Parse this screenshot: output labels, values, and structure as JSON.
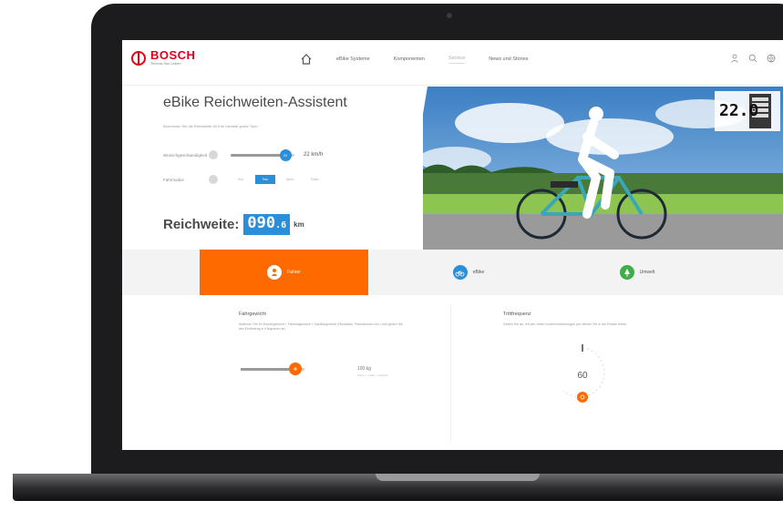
{
  "brand": {
    "name": "BOSCH",
    "subline": "Technik fürs Leben",
    "accent_color": "#e20015"
  },
  "nav": {
    "items": [
      {
        "label": "eBike Systeme"
      },
      {
        "label": "Komponenten"
      },
      {
        "label": "Service"
      },
      {
        "label": "News und Stories"
      }
    ],
    "active_index": 2
  },
  "hero": {
    "title": "eBike Reichweiten-Assistent",
    "subtitle": "Berechnen Sie die Reichweite für Ihre nächste große Tour!",
    "speed": {
      "label": "Wunschgeschwindigkeit",
      "value": "22 km/h",
      "knob_value": "22",
      "fraction": 0.85
    },
    "mode": {
      "label": "Fahrmodus",
      "options": [
        "Eco",
        "Tour",
        "Sport",
        "Turbo"
      ],
      "active_index": 1
    },
    "range": {
      "label": "Reichweite:",
      "value": "090",
      "decimal": ".6",
      "unit": "km"
    },
    "display": {
      "speed": "22.0"
    }
  },
  "tabs": [
    {
      "label": "Fahrer",
      "icon": "rider-icon",
      "color": "#ff6a00",
      "active": true
    },
    {
      "label": "eBike",
      "icon": "bike-icon",
      "color": "#2a8fd8",
      "active": false
    },
    {
      "label": "Umwelt",
      "icon": "tree-icon",
      "color": "#3fae49",
      "active": false
    }
  ],
  "weight": {
    "title": "Fahrgewicht",
    "description": "Addieren Sie Ihr Körpergewicht + Fahrradgewicht + Gepäckgewicht (Rucksack, Packtaschen etc.) und geben Sie den Endbetrag in Kilogramm an.",
    "value": "100 kg",
    "note": "Fahrer + eBike + Gepäck",
    "fraction": 0.85
  },
  "cadence": {
    "title": "Trittfrequenz",
    "description": "Geben Sie an, mit wie vielen Kurbelumdrehungen pro Minute Sie in die Pedale treten.",
    "value": "60"
  },
  "colors": {
    "orange": "#ff6a00",
    "blue": "#2a8fd8",
    "green": "#3fae49"
  }
}
